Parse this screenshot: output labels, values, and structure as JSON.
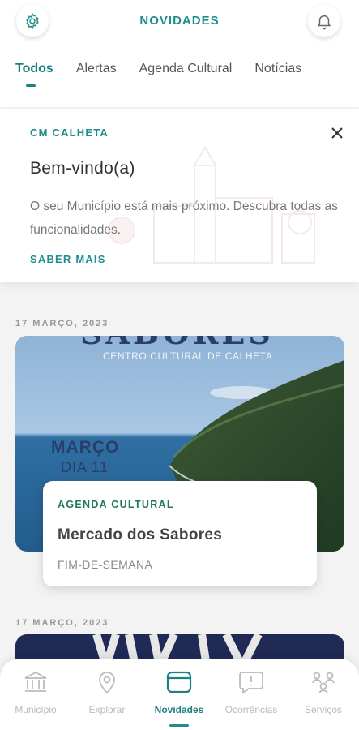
{
  "header": {
    "title": "NOVIDADES",
    "settings_icon": "gear-icon",
    "notifications_icon": "bell-icon"
  },
  "tabs": [
    {
      "label": "Todos",
      "active": true
    },
    {
      "label": "Alertas",
      "active": false
    },
    {
      "label": "Agenda Cultural",
      "active": false
    },
    {
      "label": "Notícias",
      "active": false
    }
  ],
  "welcome": {
    "org": "CM CALHETA",
    "heading": "Bem-vindo(a)",
    "body": "O seu Município está mais próximo. Descubra todas as funcionalidades.",
    "link": "SABER MAIS",
    "close_icon": "close-icon"
  },
  "feed": [
    {
      "date": "17 MARÇO, 2023",
      "image_text": {
        "top_word": "SABORES",
        "venue": "CENTRO CULTURAL DE CALHETA",
        "month": "MARÇO",
        "day": "DIA 11"
      },
      "category": "AGENDA CULTURAL",
      "title": "Mercado dos Sabores",
      "subtitle": "FIM-DE-SEMANA"
    },
    {
      "date": "17 MARÇO, 2023"
    }
  ],
  "bottom_nav": [
    {
      "label": "Município",
      "icon": "building-icon",
      "active": false
    },
    {
      "label": "Explorar",
      "icon": "map-pin-icon",
      "active": false
    },
    {
      "label": "Novidades",
      "icon": "news-icon",
      "active": true
    },
    {
      "label": "Ocorrências",
      "icon": "alert-chat-icon",
      "active": false
    },
    {
      "label": "Serviços",
      "icon": "services-icon",
      "active": false
    }
  ],
  "colors": {
    "accent": "#1f8d8d",
    "category": "#1f7a55"
  }
}
